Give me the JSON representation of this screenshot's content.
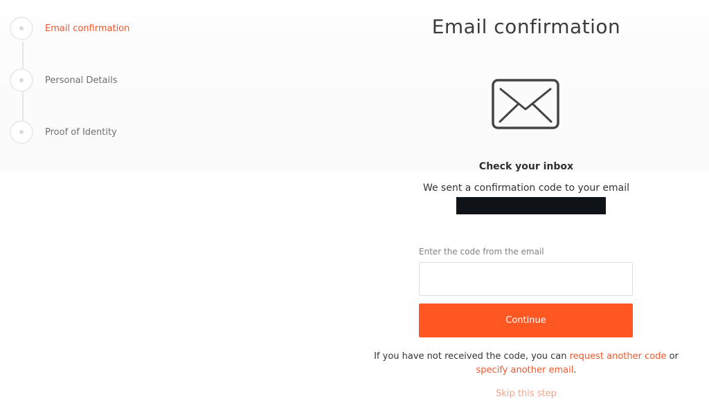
{
  "stepper": {
    "steps": [
      {
        "label": "Email confirmation",
        "active": true
      },
      {
        "label": "Personal Details",
        "active": false
      },
      {
        "label": "Proof of Identity",
        "active": false
      }
    ]
  },
  "main": {
    "title": "Email confirmation",
    "icon": "envelope-icon",
    "inbox_heading": "Check your inbox",
    "sent_text": "We sent a confirmation code to your email",
    "code_label": "Enter the code from the email",
    "code_value": "",
    "continue_label": "Continue",
    "resend": {
      "prefix": "If you have not received the code, you can ",
      "request_link": "request another code",
      "middle": " or",
      "specify_link": "specify another email",
      "suffix": "."
    },
    "skip_label": "Skip this step"
  },
  "colors": {
    "accent": "#ff5722",
    "link": "#f0562a",
    "skip": "#f7a58c",
    "redaction": "#0f1318"
  }
}
